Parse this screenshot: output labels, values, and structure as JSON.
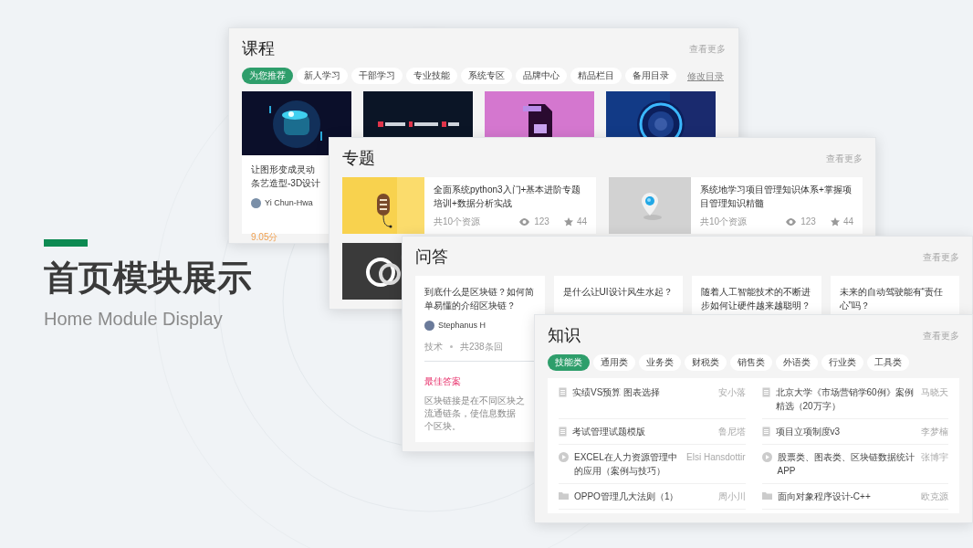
{
  "heading": {
    "title": "首页模块展示",
    "subtitle": "Home Module Display"
  },
  "course_panel": {
    "title": "课程",
    "more": "查看更多",
    "edit_link": "修改目录",
    "tabs": [
      {
        "label": "为您推荐",
        "selected": true
      },
      {
        "label": "新人学习",
        "selected": false
      },
      {
        "label": "干部学习",
        "selected": false
      },
      {
        "label": "专业技能",
        "selected": false
      },
      {
        "label": "系统专区",
        "selected": false
      },
      {
        "label": "品牌中心",
        "selected": false
      },
      {
        "label": "精品栏目",
        "selected": false
      },
      {
        "label": "备用目录",
        "selected": false
      }
    ],
    "cards": [
      {
        "kind": "full",
        "title_lines": [
          "让图形变成灵动",
          "条艺造型-3D设计"
        ],
        "author": "Yi Chun-Hwa",
        "score": "9.05分"
      },
      {
        "kind": "picture"
      },
      {
        "kind": "picture"
      },
      {
        "kind": "picture"
      }
    ]
  },
  "topic_panel": {
    "title": "专题",
    "more": "查看更多",
    "cards": [
      {
        "kind": "full",
        "title": "全面系统python3入门+基本进阶专题培训+数据分析实战",
        "count": "共10个资源",
        "views": "123",
        "favorites": "44"
      },
      {
        "kind": "full",
        "title": "系统地学习项目管理知识体系+掌握项目管理知识精髓",
        "count": "共10个资源",
        "views": "123",
        "favorites": "44"
      },
      {
        "kind": "picture"
      }
    ]
  },
  "qa_panel": {
    "title": "问答",
    "more": "查看更多",
    "cards": [
      {
        "title": "到底什么是区块链？如何简单易懂的介绍区块链？",
        "author": "Stephanus H",
        "tag": "技术",
        "answers": "共238条回",
        "best_label": "最佳答案",
        "answer_lines": [
          "区块链接是在不同区块之",
          "流通链条，使信息数据",
          "个区块。"
        ]
      },
      {
        "title": "是什么让UI设计风生水起？"
      },
      {
        "title": "随着人工智能技术的不断进步如何让硬件越来越聪明？"
      },
      {
        "title": "未来的自动驾驶能有“责任心”吗？"
      }
    ]
  },
  "knowledge_panel": {
    "title": "知识",
    "more": "查看更多",
    "tabs": [
      {
        "label": "技能类",
        "selected": true
      },
      {
        "label": "通用类",
        "selected": false
      },
      {
        "label": "业务类",
        "selected": false
      },
      {
        "label": "财税类",
        "selected": false
      },
      {
        "label": "销售类",
        "selected": false
      },
      {
        "label": "外语类",
        "selected": false
      },
      {
        "label": "行业类",
        "selected": false
      },
      {
        "label": "工具类",
        "selected": false
      }
    ],
    "items": [
      {
        "kind": "document",
        "title": "实绩VS预算  图表选择",
        "author": "安小落"
      },
      {
        "kind": "document",
        "title": "北京大学《市场营销学60例》案例精选（20万字）",
        "author": "马晓天"
      },
      {
        "kind": "document",
        "title": "考试管理试题模版",
        "author": "鲁尼塔"
      },
      {
        "kind": "document",
        "title": "项目立项制度v3",
        "author": "李梦楠"
      },
      {
        "kind": "video",
        "title": "EXCEL在人力资源管理中的应用（案例与技巧）",
        "author": "Elsi Hansdottir"
      },
      {
        "kind": "video",
        "title": "股票类、图表类、区块链数据统计APP",
        "author": "张博宇"
      },
      {
        "kind": "folder",
        "title": "OPPO管理几大法则（1）",
        "author": "周小川"
      },
      {
        "kind": "folder",
        "title": "面向对象程序设计-C++",
        "author": "欧克源"
      }
    ]
  }
}
